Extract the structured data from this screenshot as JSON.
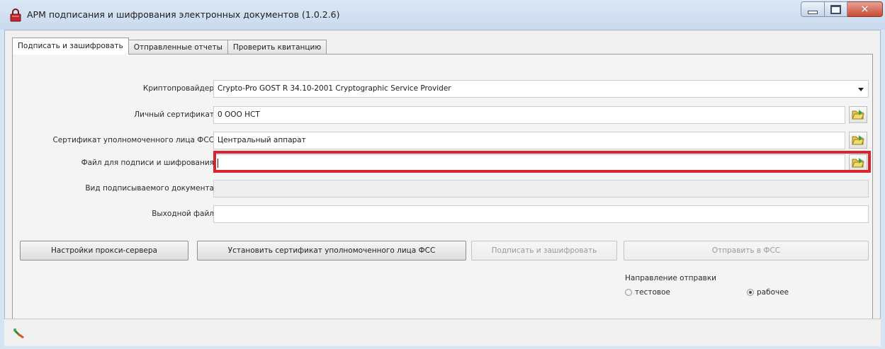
{
  "window": {
    "title": "АРМ подписания и шифрования электронных документов (1.0.2.6)",
    "controls": {
      "minimize_icon": "minimize-icon",
      "maximize_icon": "maximize-icon",
      "close_label": "✕"
    }
  },
  "tabs": [
    {
      "label": "Подписать и зашифровать",
      "active": true
    },
    {
      "label": "Отправленные отчеты",
      "active": false
    },
    {
      "label": "Проверить квитанцию",
      "active": false
    }
  ],
  "form": {
    "crypto_provider": {
      "label": "Криптопровайдер",
      "value": "Crypto-Pro GOST R 34.10-2001 Cryptographic Service Provider"
    },
    "personal_cert": {
      "label": "Личный сертификат",
      "value": "0 ООО НСТ"
    },
    "fss_cert": {
      "label": "Сертификат уполномоченного лица ФСС",
      "value": "Центральный аппарат"
    },
    "sign_file": {
      "label": "Файл для подписи и шифрования",
      "value": ""
    },
    "doc_type": {
      "label": "Вид подписываемого документа",
      "value": ""
    },
    "output_file": {
      "label": "Выходной файл",
      "value": ""
    }
  },
  "buttons": {
    "proxy_settings": "Настройки прокси-сервера",
    "install_cert": "Установить сертификат уполномоченного лица ФСС",
    "sign_encrypt": "Подписать и зашифровать",
    "send_fss": "Отправить в ФСС"
  },
  "direction": {
    "label": "Направление отправки",
    "options": [
      {
        "label": "тестовое",
        "checked": false
      },
      {
        "label": "рабочее",
        "checked": true
      }
    ]
  },
  "colors": {
    "highlight": "#d9232e",
    "title_bg": "#d7e4f2"
  }
}
